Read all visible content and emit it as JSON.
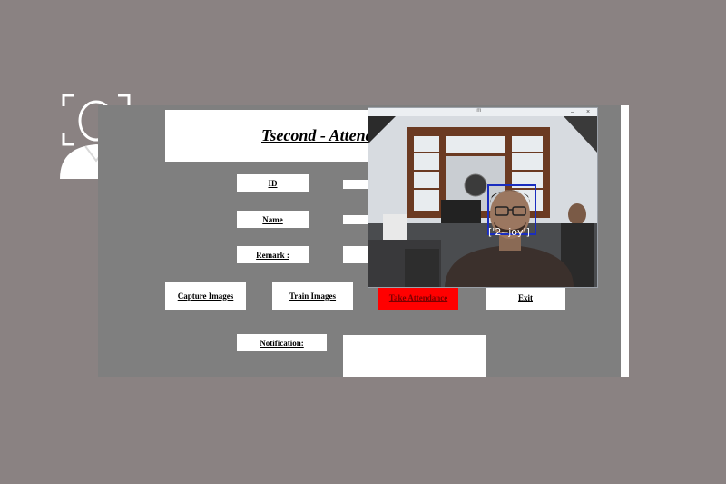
{
  "app": {
    "title": "Tsecond - Attend",
    "id_label": "ID",
    "name_label": "Name",
    "remark_label": "Remark :",
    "notification_label": "Notification:",
    "id_value": "",
    "name_value": "",
    "remark_value": "",
    "notification_text": ""
  },
  "buttons": {
    "capture": "Capture Images",
    "train": "Train Images",
    "take_attendance": "Take Attendance",
    "exit": "Exit"
  },
  "camera": {
    "window_title": "im",
    "minimize": "–",
    "close": "×",
    "detected_label": "['2--joy']",
    "box_color": "#1a2dbf"
  },
  "colors": {
    "background": "#8a8282",
    "app_bg": "#7f7f7f",
    "take_attendance": "#ff0000"
  },
  "icons": {
    "logo": "face-scan-user-icon"
  }
}
